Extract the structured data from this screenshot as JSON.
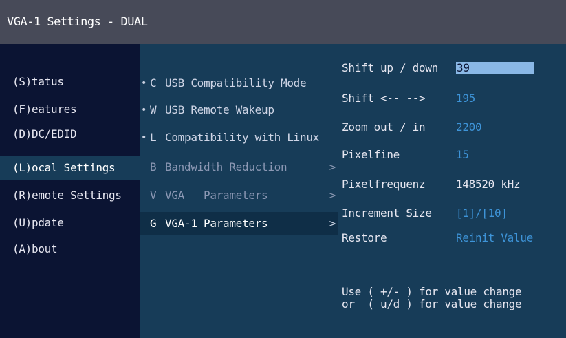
{
  "window": {
    "title": "VGA-1 Settings - DUAL"
  },
  "main_menu": {
    "items": [
      {
        "label": "(S)tatus"
      },
      {
        "label": "(F)eatures"
      },
      {
        "label": "(D)DC/EDID"
      },
      {
        "label": "(L)ocal  Settings",
        "selected": true
      },
      {
        "label": "(R)emote Settings"
      },
      {
        "label": "(U)pdate"
      },
      {
        "label": "(A)bout"
      }
    ]
  },
  "local_settings_menu": {
    "items": [
      {
        "bullet": "•",
        "key": "C",
        "label": "USB Compatibility Mode"
      },
      {
        "bullet": "•",
        "key": "W",
        "label": "USB Remote Wakeup"
      },
      {
        "bullet": "•",
        "key": "L",
        "label": "Compatibility with Linux"
      },
      {
        "key": "B",
        "label": "Bandwidth Reduction",
        "arrow": ">"
      },
      {
        "key": "V",
        "label": "VGA   Parameters",
        "arrow": ">"
      },
      {
        "key": "G",
        "label": "VGA-1 Parameters",
        "arrow": ">",
        "selected": true
      }
    ]
  },
  "vga1_parameters": {
    "rows": [
      {
        "label": "Shift up / down",
        "value": "39"
      },
      {
        "label": "Shift <-- -->",
        "value": "195"
      },
      {
        "label": "Zoom out / in",
        "value": "2200"
      },
      {
        "label": "Pixelfine",
        "value": "15"
      },
      {
        "label": "Pixelfrequenz",
        "value": "148520 kHz"
      },
      {
        "label": "Increment Size",
        "value": "[1]/[10]"
      },
      {
        "label": "Restore",
        "value": "Reinit Value"
      }
    ],
    "help_line_1": "Use ( +/- ) for value change",
    "help_line_2": "or  ( u/d ) for value change"
  },
  "colors": {
    "title_bar": "#474a58",
    "background": "#0b1433",
    "panel": "#173c58",
    "value_blue": "#3e94d8",
    "highlight": "#8ab8e6"
  }
}
